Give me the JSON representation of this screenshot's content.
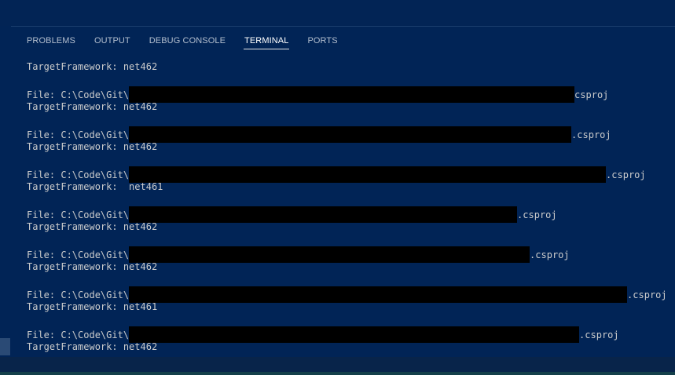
{
  "panel": {
    "tabs": [
      {
        "label": "PROBLEMS",
        "active": false
      },
      {
        "label": "OUTPUT",
        "active": false
      },
      {
        "label": "DEBUG CONSOLE",
        "active": false
      },
      {
        "label": "TERMINAL",
        "active": true
      },
      {
        "label": "PORTS",
        "active": false
      }
    ]
  },
  "terminal": {
    "lines": [
      {
        "text": "TargetFramework: net462"
      },
      {
        "prefix": "File: C:\\Code\\Git\\",
        "suffix": "csproj"
      },
      {
        "text": "TargetFramework: net462"
      },
      {
        "prefix": "File: C:\\Code\\Git\\",
        "suffix": ".csproj"
      },
      {
        "text": "TargetFramework: net462"
      },
      {
        "prefix": "File: C:\\Code\\Git\\",
        "suffix": ".csproj"
      },
      {
        "text": "TargetFramework:  net461"
      },
      {
        "prefix": "File: C:\\Code\\Git\\",
        "suffix": ".csproj"
      },
      {
        "text": "TargetFramework: net462"
      },
      {
        "prefix": "File: C:\\Code\\Git\\",
        "suffix": ".csproj"
      },
      {
        "text": "TargetFramework: net462"
      },
      {
        "prefix": "File: C:\\Code\\Git\\",
        "suffix": ".csproj"
      },
      {
        "text": "TargetFramework: net461"
      },
      {
        "prefix": "File: C:\\Code\\Git\\",
        "suffix": ".csproj"
      },
      {
        "text": "TargetFramework: net462"
      }
    ]
  }
}
